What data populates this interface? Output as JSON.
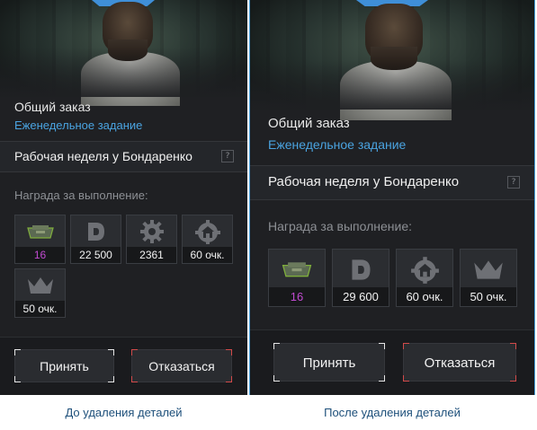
{
  "before": {
    "order_title": "Общий заказ",
    "order_subtitle": "Еженедельное задание",
    "task_name": "Рабочая неделя у Бондаренко",
    "help": "?",
    "reward_label": "Награда за выполнение:",
    "rewards": [
      {
        "icon": "crate-icon",
        "value": "16",
        "highlight": true
      },
      {
        "icon": "d-currency-icon",
        "value": "22 500"
      },
      {
        "icon": "gear-icon",
        "value": "2361"
      },
      {
        "icon": "house-gear-icon",
        "value": "60 очк."
      },
      {
        "icon": "crown-icon",
        "value": "50 очк."
      }
    ],
    "accept_label": "Принять",
    "decline_label": "Отказаться",
    "caption": "До удаления деталей"
  },
  "after": {
    "order_title": "Общий заказ",
    "order_subtitle": "Еженедельное задание",
    "task_name": "Рабочая неделя у Бондаренко",
    "help": "?",
    "reward_label": "Награда за выполнение:",
    "rewards": [
      {
        "icon": "crate-icon",
        "value": "16",
        "highlight": true
      },
      {
        "icon": "d-currency-icon",
        "value": "29 600"
      },
      {
        "icon": "house-gear-icon",
        "value": "60 очк."
      },
      {
        "icon": "crown-icon",
        "value": "50 очк."
      }
    ],
    "accept_label": "Принять",
    "decline_label": "Отказаться",
    "caption": "После удаления деталей"
  },
  "colors": {
    "accent_blue": "#4aa3e0",
    "highlight_purple": "#c04ad0",
    "decline_red": "#d24a4a"
  }
}
